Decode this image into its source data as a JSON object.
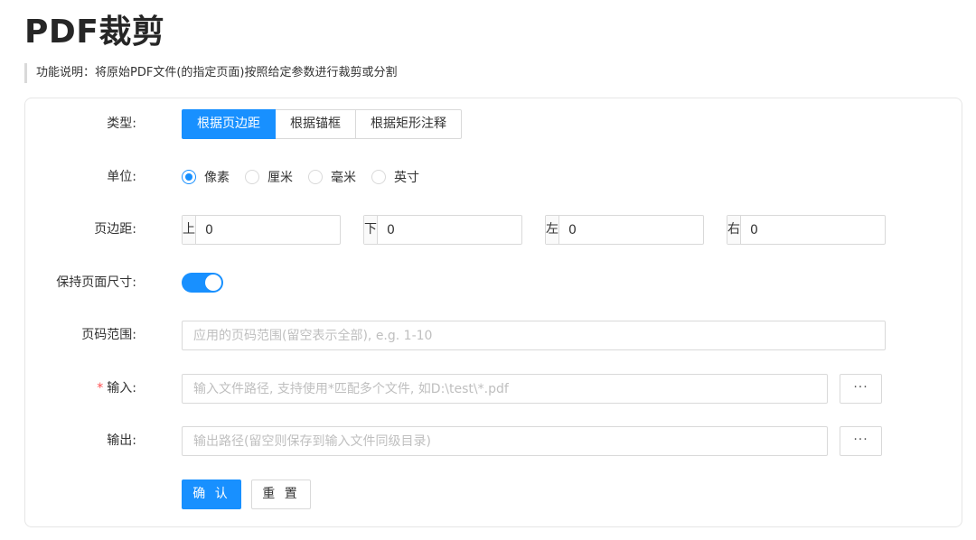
{
  "page": {
    "title": "PDF裁剪",
    "description": "功能说明：将原始PDF文件(的指定页面)按照给定参数进行裁剪或分割"
  },
  "form": {
    "type": {
      "label": "类型:",
      "options": [
        "根据页边距",
        "根据锚框",
        "根据矩形注释"
      ],
      "selected": "根据页边距"
    },
    "unit": {
      "label": "单位:",
      "options": [
        "像素",
        "厘米",
        "毫米",
        "英寸"
      ],
      "selected": "像素"
    },
    "margins": {
      "label": "页边距:",
      "top": {
        "addon": "上",
        "value": "0"
      },
      "bottom": {
        "addon": "下",
        "value": "0"
      },
      "left": {
        "addon": "左",
        "value": "0"
      },
      "right": {
        "addon": "右",
        "value": "0"
      }
    },
    "keep_size": {
      "label": "保持页面尺寸:",
      "checked": true
    },
    "page_range": {
      "label": "页码范围:",
      "value": "",
      "placeholder": "应用的页码范围(留空表示全部), e.g. 1-10"
    },
    "input": {
      "required_mark": "*",
      "label": "输入:",
      "value": "",
      "placeholder": "输入文件路径, 支持使用*匹配多个文件, 如D:\\test\\*.pdf",
      "browse_label": "···"
    },
    "output": {
      "label": "输出:",
      "value": "",
      "placeholder": "输出路径(留空则保存到输入文件同级目录)",
      "browse_label": "···"
    },
    "actions": {
      "confirm_label": "确 认",
      "reset_label": "重 置"
    }
  },
  "colors": {
    "primary": "#1890ff",
    "border": "#d9d9d9",
    "required": "#ff4d4f",
    "placeholder": "#bfbfbf"
  }
}
